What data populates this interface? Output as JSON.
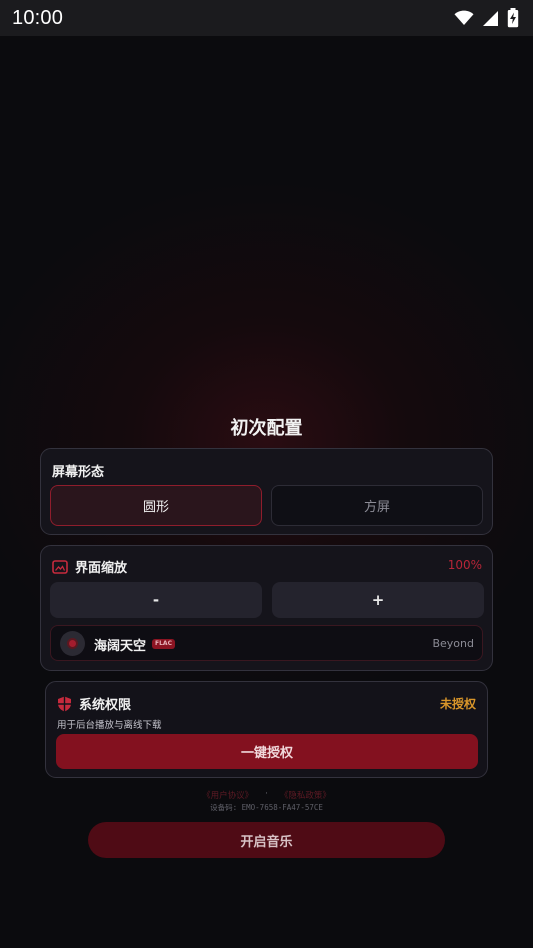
{
  "status_bar": {
    "time": "10:00"
  },
  "page": {
    "title": "初次配置"
  },
  "screen_shape": {
    "label": "屏幕形态",
    "options": [
      {
        "label": "圆形",
        "selected": true
      },
      {
        "label": "方屏",
        "selected": false
      }
    ]
  },
  "ui_scale": {
    "label": "界面缩放",
    "value": "100%",
    "decrease_label": "-",
    "increase_label": "+",
    "preview": {
      "title": "海阔天空",
      "badge": "FLAC",
      "artist": "Beyond"
    }
  },
  "permissions": {
    "label": "系统权限",
    "status": "未授权",
    "description": "用于后台播放与离线下载",
    "authorize_label": "一键授权"
  },
  "footer": {
    "user_agreement": "《用户协议》",
    "separator": "·",
    "privacy_policy": "《隐私政策》",
    "device_code": "设备码: EMO-7658-FA47-57CE",
    "start_label": "开启音乐"
  },
  "colors": {
    "accent": "#83111f",
    "accent_text": "#b62537",
    "warning": "#d9962a",
    "card_bg": "#15141b"
  }
}
